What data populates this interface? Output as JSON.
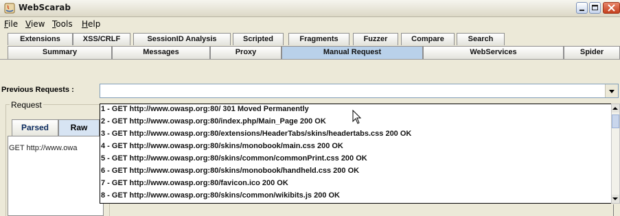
{
  "window": {
    "title": "WebScarab"
  },
  "menu": [
    "File",
    "View",
    "Tools",
    "Help"
  ],
  "tabs_row1": [
    "Extensions",
    "XSS/CRLF",
    "SessionID Analysis",
    "Scripted",
    "Fragments",
    "Fuzzer",
    "Compare",
    "Search"
  ],
  "tabs_row2": [
    "Summary",
    "Messages",
    "Proxy",
    "Manual Request",
    "WebServices",
    "Spider"
  ],
  "active_tab": "Manual Request",
  "previous_requests": {
    "label": "Previous Requests :",
    "value": ""
  },
  "request_panel": {
    "title": "Request",
    "tabs": [
      "Parsed",
      "Raw"
    ],
    "text": "GET http://www.owa"
  },
  "dropdown_items": [
    "1 - GET http://www.owasp.org:80/   301 Moved Permanently",
    "2 - GET http://www.owasp.org:80/index.php/Main_Page   200 OK",
    "3 - GET http://www.owasp.org:80/extensions/HeaderTabs/skins/headertabs.css   200 OK",
    "4 - GET http://www.owasp.org:80/skins/monobook/main.css   200 OK",
    "5 - GET http://www.owasp.org:80/skins/common/commonPrint.css   200 OK",
    "6 - GET http://www.owasp.org:80/skins/monobook/handheld.css   200 OK",
    "7 - GET http://www.owasp.org:80/favicon.ico   200 OK",
    "8 - GET http://www.owasp.org:80/skins/common/wikibits.js   200 OK"
  ],
  "colors": {
    "active_tab": "#b9d1ea",
    "window_bg": "#ece9d8",
    "close_button": "#c4401e"
  }
}
